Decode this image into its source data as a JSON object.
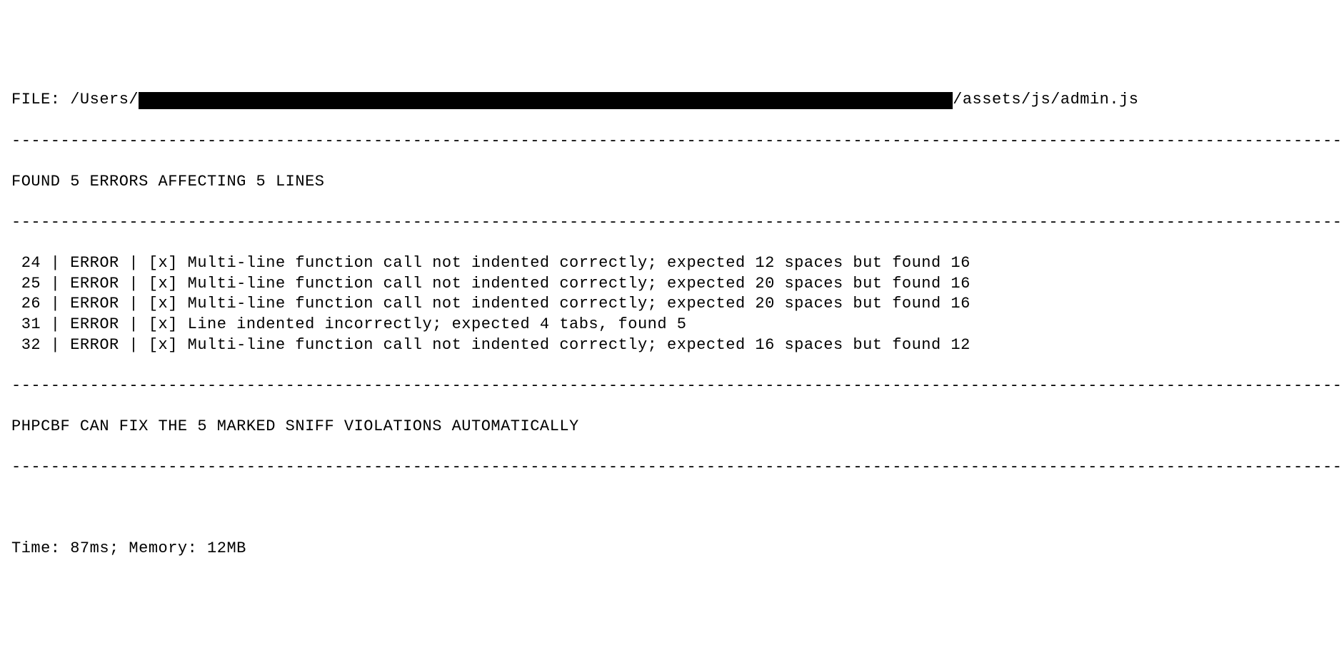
{
  "file": {
    "label": "FILE: ",
    "path_prefix": "/Users/",
    "path_suffix": "/assets/js/admin.js"
  },
  "divider": "----------------------------------------------------------------------------------------------------------------------------------------------------------",
  "summary": "FOUND 5 ERRORS AFFECTING 5 LINES",
  "errors": [
    {
      "line": "24",
      "severity": "ERROR",
      "fixable": "[x]",
      "message": "Multi-line function call not indented correctly; expected 12 spaces but found 16"
    },
    {
      "line": "25",
      "severity": "ERROR",
      "fixable": "[x]",
      "message": "Multi-line function call not indented correctly; expected 20 spaces but found 16"
    },
    {
      "line": "26",
      "severity": "ERROR",
      "fixable": "[x]",
      "message": "Multi-line function call not indented correctly; expected 20 spaces but found 16"
    },
    {
      "line": "31",
      "severity": "ERROR",
      "fixable": "[x]",
      "message": "Line indented incorrectly; expected 4 tabs, found 5"
    },
    {
      "line": "32",
      "severity": "ERROR",
      "fixable": "[x]",
      "message": "Multi-line function call not indented correctly; expected 16 spaces but found 12"
    }
  ],
  "fix_note": "PHPCBF CAN FIX THE 5 MARKED SNIFF VIOLATIONS AUTOMATICALLY",
  "footer": "Time: 87ms; Memory: 12MB"
}
